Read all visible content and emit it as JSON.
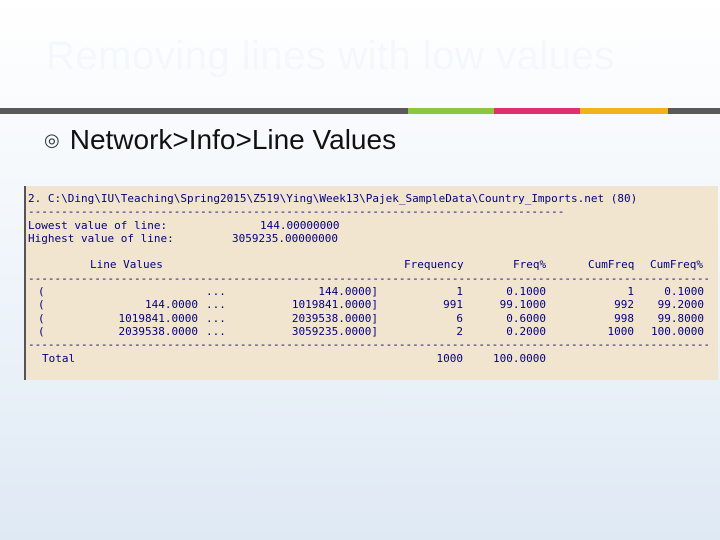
{
  "slide": {
    "title": "Removing lines with low values",
    "bullet": "Network>Info>Line Values",
    "accent_colors": [
      "#595959",
      "#8cc63f",
      "#e0306f",
      "#f2b21b"
    ]
  },
  "report": {
    "path_line": "2. C:\\Ding\\IU\\Teaching\\Spring2015\\Z519\\Ying\\Week13\\Pajek_SampleData\\Country_Imports.net (80)",
    "lowest_label": "Lowest value of line:",
    "lowest_value": "144.00000000",
    "highest_label": "Highest value of line:",
    "highest_value": "3059235.00000000",
    "headers": {
      "line_values": "Line Values",
      "frequency": "Frequency",
      "freq_pct": "Freq%",
      "cum_freq": "CumFreq",
      "cum_freq_pct": "CumFreq%"
    },
    "rows": [
      {
        "open": "(",
        "low": "",
        "dots": "...",
        "high": "144.0000]",
        "freq": "1",
        "freq_pct": "0.1000",
        "cum": "1",
        "cum_pct": "0.1000"
      },
      {
        "open": "(",
        "low": "144.0000",
        "dots": "...",
        "high": "1019841.0000]",
        "freq": "991",
        "freq_pct": "99.1000",
        "cum": "992",
        "cum_pct": "99.2000"
      },
      {
        "open": "(",
        "low": "1019841.0000",
        "dots": "...",
        "high": "2039538.0000]",
        "freq": "6",
        "freq_pct": "0.6000",
        "cum": "998",
        "cum_pct": "99.8000"
      },
      {
        "open": "(",
        "low": "2039538.0000",
        "dots": "...",
        "high": "3059235.0000]",
        "freq": "2",
        "freq_pct": "0.2000",
        "cum": "1000",
        "cum_pct": "100.0000"
      }
    ],
    "total": {
      "label": "Total",
      "freq": "1000",
      "freq_pct": "100.0000"
    }
  }
}
